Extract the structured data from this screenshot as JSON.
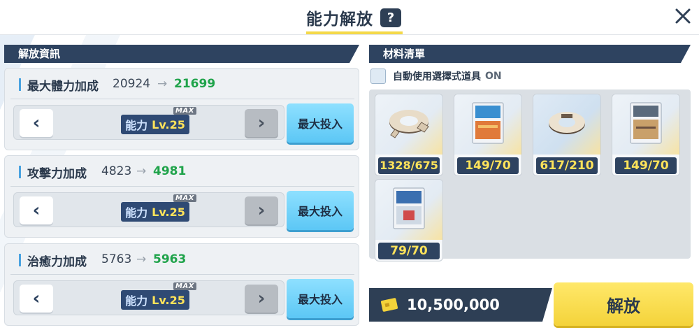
{
  "header": {
    "title": "能力解放",
    "help_label": "?"
  },
  "left_section": {
    "title": "解放資訊"
  },
  "stats": [
    {
      "name": "最大體力加成",
      "old": "20924",
      "new": "21699",
      "level_label": "能力",
      "level_value": "Lv.25",
      "max_tag": "MAX",
      "max_invest_label": "最大投入"
    },
    {
      "name": "攻擊力加成",
      "old": "4823",
      "new": "4981",
      "level_label": "能力",
      "level_value": "Lv.25",
      "max_tag": "MAX",
      "max_invest_label": "最大投入"
    },
    {
      "name": "治癒力加成",
      "old": "5763",
      "new": "5963",
      "level_label": "能力",
      "level_value": "Lv.25",
      "max_tag": "MAX",
      "max_invest_label": "最大投入"
    }
  ],
  "right_section": {
    "title": "材料清單",
    "auto_use_label": "自動使用選擇式道具",
    "auto_use_state": "ON"
  },
  "materials": [
    {
      "icon": "gear-ring-fragment-icon",
      "count": "1328/675"
    },
    {
      "icon": "physical-education-book-icon",
      "count": "149/70"
    },
    {
      "icon": "gear-ring-icon",
      "count": "617/210"
    },
    {
      "icon": "firearms-training-book-icon",
      "count": "149/70"
    },
    {
      "icon": "health-education-book-icon",
      "count": "79/70"
    }
  ],
  "cost": {
    "value": "10,500,000",
    "icon": "credit-coin-icon"
  },
  "release_button": {
    "label": "解放"
  },
  "colors": {
    "accent_yellow": "#f4d33a",
    "navy": "#2e4360",
    "green": "#1fa34a",
    "cyan": "#5cc7f5"
  }
}
